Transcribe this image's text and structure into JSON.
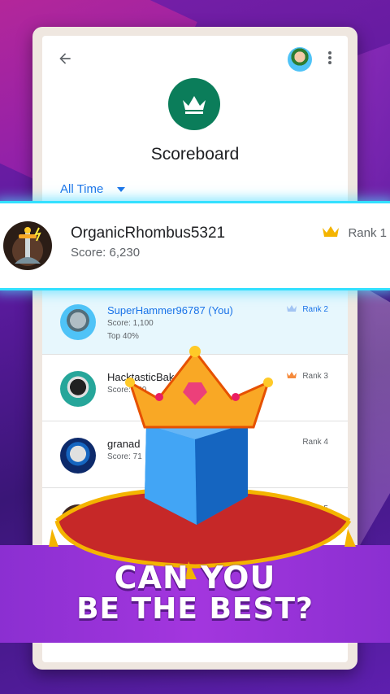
{
  "header": {
    "title": "Scoreboard",
    "filter_label": "All Time",
    "back_icon": "arrow-back-icon",
    "menu_icon": "more-vert-icon"
  },
  "highlight": {
    "name": "OrganicRhombus5321",
    "score": "Score: 6,230",
    "rank": "Rank 1"
  },
  "leaderboard": [
    {
      "name": "SuperHammer96787 (You)",
      "score": "Score: 1,100",
      "top": "Top 40%",
      "rank": "Rank 2"
    },
    {
      "name": "HacktasticBaker123",
      "score": "Score: 720",
      "rank": "Rank 3"
    },
    {
      "name": "granad",
      "score": "Score: 71",
      "rank": "Rank 4"
    },
    {
      "name": "",
      "score": "",
      "rank": "Rank 5"
    }
  ],
  "promo": {
    "line1": "CAN YOU",
    "line2": "BE THE BEST?"
  },
  "colors": {
    "accent": "#1a73e8",
    "crown_badge": "#0b7d5a",
    "highlight_glow": "#33e0ff",
    "promo_band": "#a336de"
  }
}
